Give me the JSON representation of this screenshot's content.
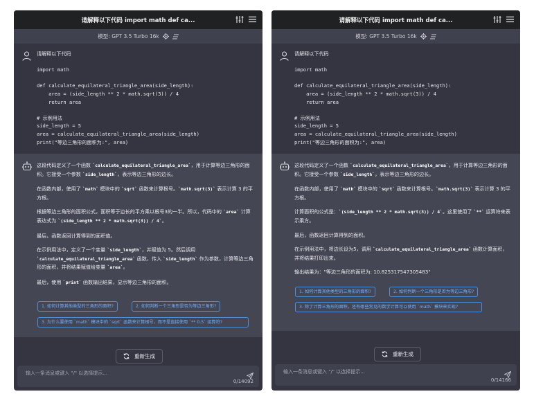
{
  "panels": [
    {
      "title": "请解释以下代码 import math def ca...",
      "model_label": "模型: GPT 3.5 Turbo 16k",
      "user_lines": [
        "请解释以下代码",
        "",
        "import math",
        "",
        "def calculate_equilateral_triangle_area(side_length):",
        "    area = (side_length ** 2 * math.sqrt(3)) / 4",
        "    return area",
        "",
        "# 示例用法",
        "side_length = 5",
        "area = calculate_equilateral_triangle_area(side_length)",
        "print(\"等边三角形的面积为:\", area)"
      ],
      "bot_paragraphs": [
        [
          {
            "t": "这段代码定义了一个函数 "
          },
          {
            "c": "`calculate_equilateral_triangle_area`"
          },
          {
            "t": "，用于计算等边三角形的面积。它接受一个参数 "
          },
          {
            "c": "`side_length`"
          },
          {
            "t": "，表示等边三角形的边长。"
          }
        ],
        [
          {
            "t": "在函数内部，使用了 "
          },
          {
            "c": "`math`"
          },
          {
            "t": " 模块中的 "
          },
          {
            "c": "`sqrt`"
          },
          {
            "t": " 函数来计算根号。"
          },
          {
            "c": "`math.sqrt(3)`"
          },
          {
            "t": " 表示计算 3 的平方根。"
          }
        ],
        [
          {
            "t": "根据等边三角形的面积公式，面积等于边长的平方乘以根号3的一半。所以，代码中的 "
          },
          {
            "c": "`area`"
          },
          {
            "t": " 计算表达式为 "
          },
          {
            "c": "`(side_length ** 2 * math.sqrt(3)) / 4`"
          },
          {
            "t": "。"
          }
        ],
        [
          {
            "t": "最后，函数返回计算得到的面积值。"
          }
        ],
        [
          {
            "t": "在示例用法中，定义了一个变量 "
          },
          {
            "c": "`side_length`"
          },
          {
            "t": "，并赋值为 5。然后调用 "
          },
          {
            "c": "`calculate_equilateral_triangle_area`"
          },
          {
            "t": " 函数，传入 "
          },
          {
            "c": "`side_length`"
          },
          {
            "t": " 作为参数，计算等边三角形的面积，并将结果赋值给变量 "
          },
          {
            "c": "`area`"
          },
          {
            "t": "。"
          }
        ],
        [
          {
            "t": "最后，使用 "
          },
          {
            "c": "`print`"
          },
          {
            "t": " 函数输出结果，显示等边三角形的面积。"
          }
        ]
      ],
      "suggestions": [
        "1. 如何计算其他类型的三角形的面积?",
        "2. 如何判断一个三角形是否为等边三角形?",
        "3. 为什么要使用 `math` 模块中的 `sqrt` 函数来计算根号，而不是直接使用 `** 0.5` 运算符?"
      ],
      "regenerate_label": "重新生成",
      "input_placeholder": "输入一条消息或键入 \"/\" 以选择提示...",
      "char_count": "0/14092"
    },
    {
      "title": "请解释以下代码 import math def ca...",
      "model_label": "模型: GPT 3.5 Turbo 16k",
      "user_lines": [
        "请解释以下代码",
        "",
        "import math",
        "",
        "def calculate_equilateral_triangle_area(side_length):",
        "    area = (side_length ** 2 * math.sqrt(3)) / 4",
        "    return area",
        "",
        "# 示例用法",
        "side_length = 5",
        "area = calculate_equilateral_triangle_area(side_length)",
        "print(\"等边三角形的面积为:\", area)"
      ],
      "bot_paragraphs": [
        [
          {
            "t": "这段代码定义了一个函数 "
          },
          {
            "c": "`calculate_equilateral_triangle_area`"
          },
          {
            "t": "，用于计算等边三角形的面积。它接受一个参数 "
          },
          {
            "c": "`side_length`"
          },
          {
            "t": "，表示等边三角形的边长。"
          }
        ],
        [
          {
            "t": "在函数内部，使用了 "
          },
          {
            "c": "`math`"
          },
          {
            "t": " 模块中的 "
          },
          {
            "c": "`sqrt`"
          },
          {
            "t": " 函数来计算根号。"
          },
          {
            "c": "`math.sqrt(3)`"
          },
          {
            "t": " 表示计算 3 的平方根。"
          }
        ],
        [
          {
            "t": "计算面积的公式是："
          },
          {
            "c": "`(side_length ** 2 * math.sqrt(3)) / 4`"
          },
          {
            "t": "。这里使用了 "
          },
          {
            "c": "`**`"
          },
          {
            "t": " 运算符来表示乘方。"
          }
        ],
        [
          {
            "t": "最后，函数返回计算得到的面积。"
          }
        ],
        [
          {
            "t": "在示例用法中，将边长设为5，调用 "
          },
          {
            "c": "`calculate_equilateral_triangle_area`"
          },
          {
            "t": " 函数计算面积，并将结果打印出来。"
          }
        ],
        [
          {
            "t": "输出结果为：\"等边三角形的面积为: 10.825317547305483\""
          }
        ]
      ],
      "suggestions": [
        "1. 如何计算其他类型的三角形的面积?",
        "2. 如何判断一个三角形是否为等边三角形?",
        "3. 除了计算三角形的面积，还有哪些常见的数学计算可以使用 `math` 模块来实现?"
      ],
      "regenerate_label": "重新生成",
      "input_placeholder": "输入一条消息或键入 \"/\" 以选择提示...",
      "char_count": "0/14166"
    }
  ]
}
